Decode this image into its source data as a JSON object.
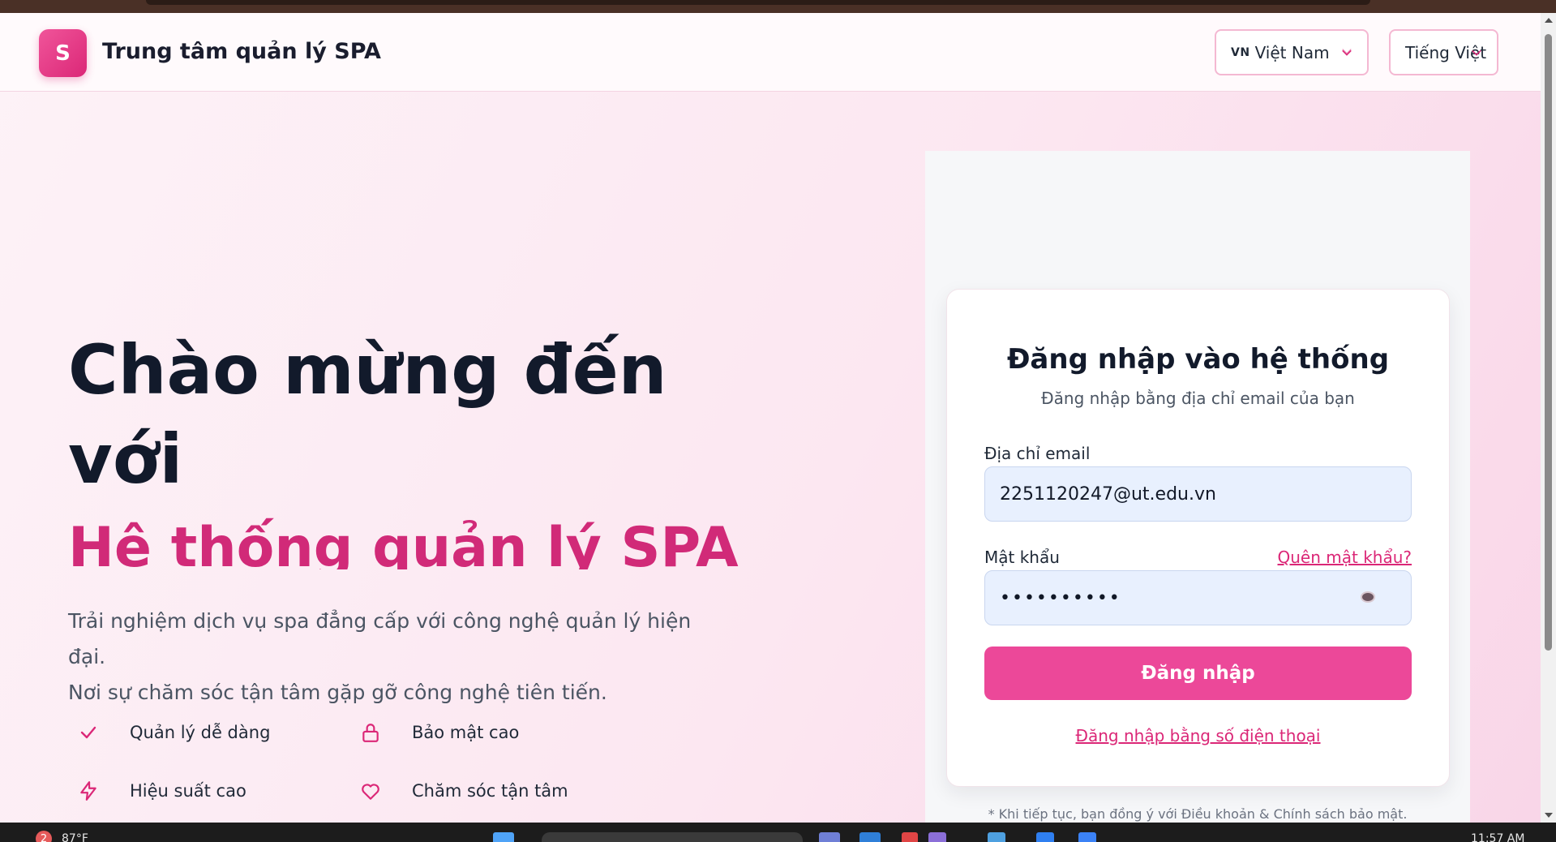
{
  "header": {
    "logo_letter": "S",
    "brand": "Trung tâm quản lý SPA",
    "country_flag": "VN",
    "country_label": "Việt Nam",
    "language_label": "Tiếng Việt"
  },
  "hero": {
    "title": "Chào mừng đến với",
    "subtitle": "Hệ thống quản lý SPA",
    "description_line1": "Trải nghiệm dịch vụ spa đẳng cấp với công nghệ quản lý hiện đại.",
    "description_line2": "Nơi sự chăm sóc tận tâm gặp gỡ công nghệ tiên tiến.",
    "features": [
      {
        "label": "Quản lý dễ dàng",
        "icon": "check-icon"
      },
      {
        "label": "Bảo mật cao",
        "icon": "lock-icon"
      },
      {
        "label": "Hiệu suất cao",
        "icon": "lightning-icon"
      },
      {
        "label": "Chăm sóc tận tâm",
        "icon": "heart-icon"
      }
    ]
  },
  "login": {
    "title": "Đăng nhập vào hệ thống",
    "subtitle": "Đăng nhập bằng địa chỉ email của bạn",
    "email_label": "Địa chỉ email",
    "email_value": "2251120247@ut.edu.vn",
    "password_label": "Mật khẩu",
    "forgot_link": "Quên mật khẩu?",
    "password_value": "••••••••••",
    "submit_label": "Đăng nhập",
    "phone_link": "Đăng nhập bằng số điện thoại",
    "terms": "* Khi tiếp tục, bạn đồng ý với Điều khoản & Chính sách bảo mật."
  },
  "taskbar": {
    "notification_count": "2",
    "temperature": "87°F",
    "clock": "11:57 AM"
  },
  "colors": {
    "accent": "#db2777",
    "button": "#ec4899",
    "title": "#121a2b",
    "input_bg": "#e8f0fe"
  }
}
